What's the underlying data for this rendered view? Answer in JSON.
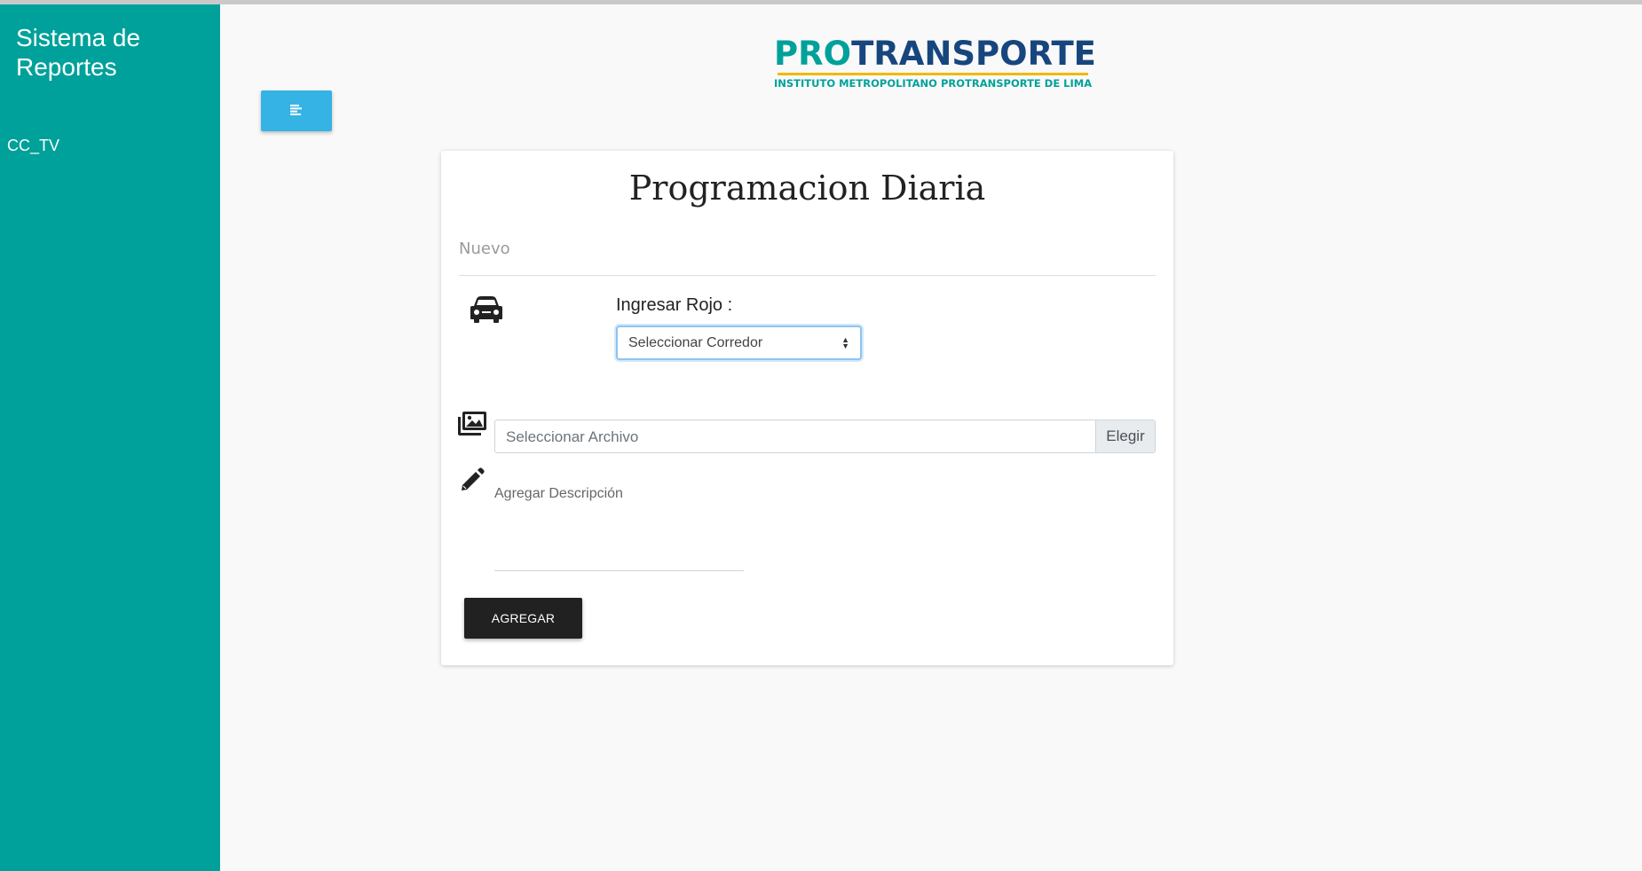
{
  "sidebar": {
    "title": "Sistema de Reportes",
    "items": [
      {
        "label": "CC_TV"
      }
    ],
    "color": "#00a19a"
  },
  "header": {
    "toggle_icon": "align-left-icon",
    "toggle_color": "#35b3e5",
    "logo": {
      "part1": "PRO",
      "part2": "TRANSPORTE",
      "subtitle": "INSTITUTO METROPOLITANO PROTRANSPORTE DE LIMA"
    }
  },
  "form": {
    "title": "Programacion Diaria",
    "subtitle": "Nuevo",
    "corridor_icon": "car-icon",
    "corridor_label": "Ingresar Rojo :",
    "corridor_select": {
      "selected": "Seleccionar Corredor"
    },
    "file_icon": "images-icon",
    "file_input": {
      "placeholder": "Seleccionar Archivo",
      "button_label": "Elegir"
    },
    "description_icon": "pencil-icon",
    "description": {
      "placeholder": "Agregar Descripción",
      "value": ""
    },
    "submit_label": "AGREGAR"
  }
}
